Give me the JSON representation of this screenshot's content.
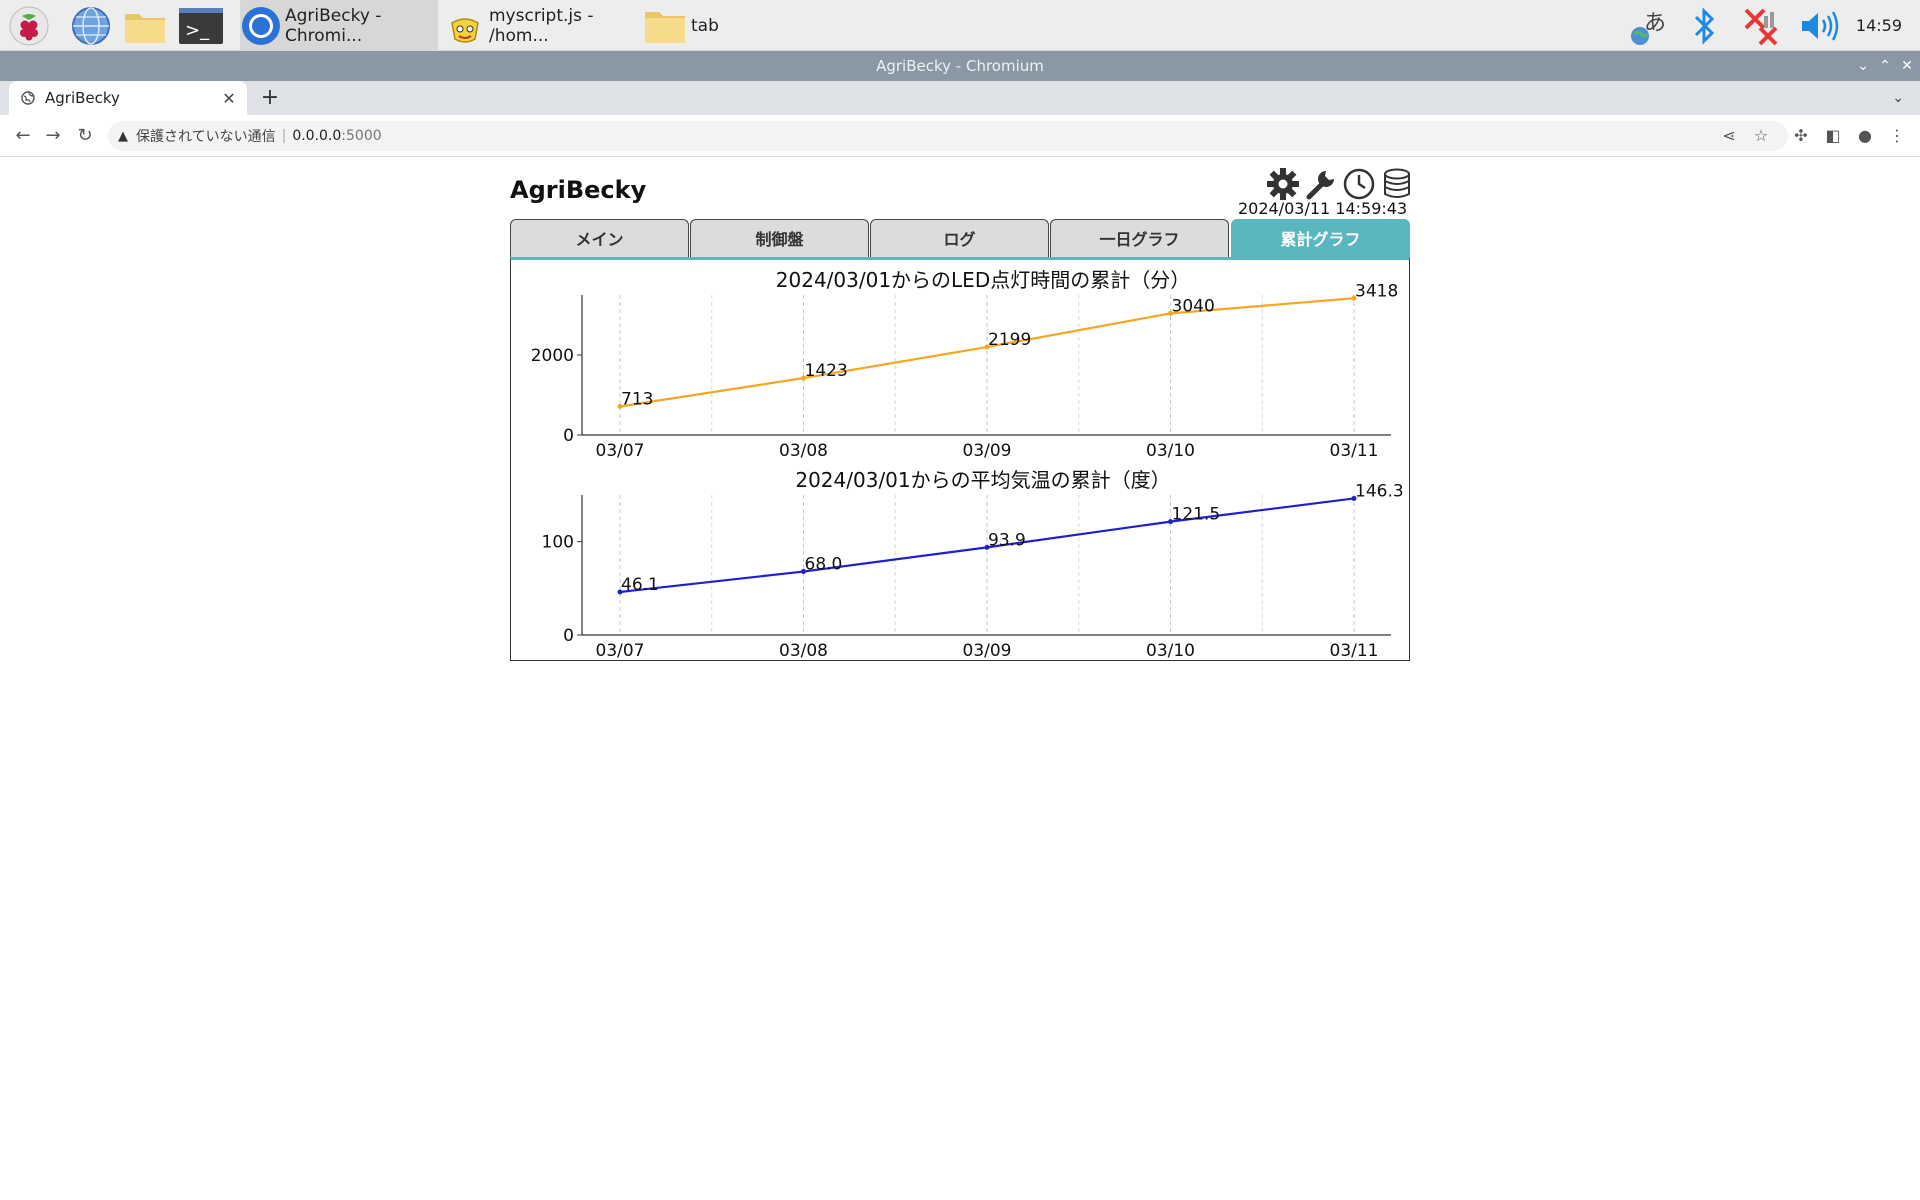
{
  "taskbar": {
    "apps": [
      {
        "label": "AgriBecky - Chromi...",
        "icon": "chromium-icon"
      },
      {
        "label": "myscript.js - /hom...",
        "icon": "geany-icon"
      },
      {
        "label": "tab",
        "icon": "folder-icon"
      }
    ],
    "clock": "14:59",
    "ime_char": "あ"
  },
  "window": {
    "title": "AgriBecky - Chromium"
  },
  "browser": {
    "tab_title": "AgriBecky",
    "security_text": "保護されていない通信",
    "url_host": "0.0.0.0",
    "url_port": ":5000"
  },
  "app": {
    "title": "AgriBecky",
    "datetime": "2024/03/11 14:59:43",
    "tabs": [
      "メイン",
      "制御盤",
      "ログ",
      "一日グラフ",
      "累計グラフ"
    ],
    "active_tab": 4
  },
  "chart_data": [
    {
      "type": "line",
      "title": "2024/03/01からのLED点灯時間の累計（分）",
      "x": [
        "03/07",
        "03/08",
        "03/09",
        "03/10",
        "03/11"
      ],
      "series": [
        {
          "values": [
            713,
            1423,
            2199,
            3040,
            3418
          ],
          "color": "#f5a623",
          "labels": [
            "713",
            "1423",
            "2199",
            "3040",
            "3418"
          ]
        }
      ],
      "yticks": [
        "0",
        "2000"
      ],
      "ylim": [
        0,
        3500
      ],
      "grid": "vertical dashed"
    },
    {
      "type": "line",
      "title": "2024/03/01からの平均気温の累計（度）",
      "x": [
        "03/07",
        "03/08",
        "03/09",
        "03/10",
        "03/11"
      ],
      "series": [
        {
          "values": [
            46.1,
            68.0,
            93.9,
            121.5,
            146.3
          ],
          "color": "#1f1fcf",
          "labels": [
            "46.1",
            "68.0",
            "93.9",
            "121.5",
            "146.3"
          ]
        }
      ],
      "yticks": [
        "0",
        "100"
      ],
      "ylim": [
        0,
        150
      ],
      "grid": "vertical dashed"
    }
  ]
}
